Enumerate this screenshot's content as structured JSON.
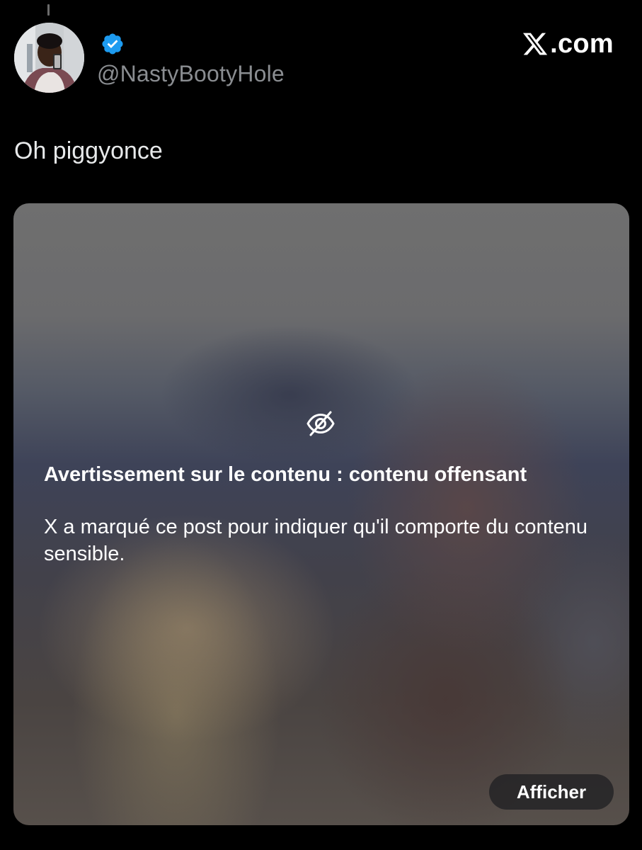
{
  "post": {
    "author_handle": "@NastyBootyHole",
    "verified": true,
    "text": "Oh piggyonce"
  },
  "brand": {
    "text": ".com",
    "icon": "x-logo-icon"
  },
  "media": {
    "warning_icon": "eye-slash-icon",
    "warning_title": "Avertissement sur le contenu : contenu offensant",
    "warning_body": "X a marqué ce post pour indiquer qu'il comporte du contenu sensible.",
    "show_button_label": "Afficher"
  },
  "colors": {
    "background": "#000000",
    "handle_text": "#8a8d91",
    "verified_badge": "#1d9bf0",
    "primary_text": "#e7e9ea",
    "button_background": "#202022"
  }
}
